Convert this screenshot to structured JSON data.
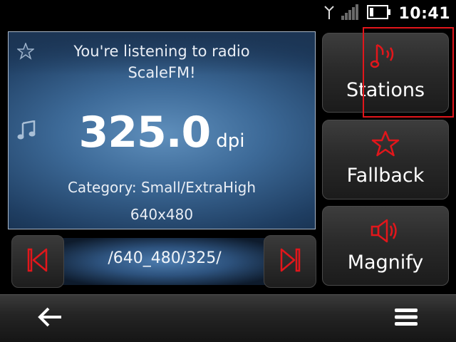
{
  "status": {
    "time": "10:41"
  },
  "now_playing": {
    "line1": "You're listening to radio",
    "line2": "ScaleFM!",
    "frequency": "325.0",
    "unit": "dpi",
    "category": "Category: Small/ExtraHigh",
    "resolution": "640x480"
  },
  "preset": {
    "path": "/640_480/325/"
  },
  "side_buttons": {
    "stations": "Stations",
    "fallback": "Fallback",
    "magnify": "Magnify"
  },
  "colors": {
    "accent": "#e2161b",
    "panel": "#3d6a98"
  },
  "icons": {
    "signal": "signal-icon",
    "battery": "battery-icon",
    "antenna": "antenna-icon",
    "favorite": "star-icon",
    "music": "music-note-icon",
    "prev": "skip-previous-icon",
    "next": "skip-next-icon",
    "stations": "music-sound-icon",
    "fallback": "star-outline-icon",
    "magnify": "speaker-icon",
    "back": "back-arrow-icon",
    "menu": "menu-icon"
  }
}
